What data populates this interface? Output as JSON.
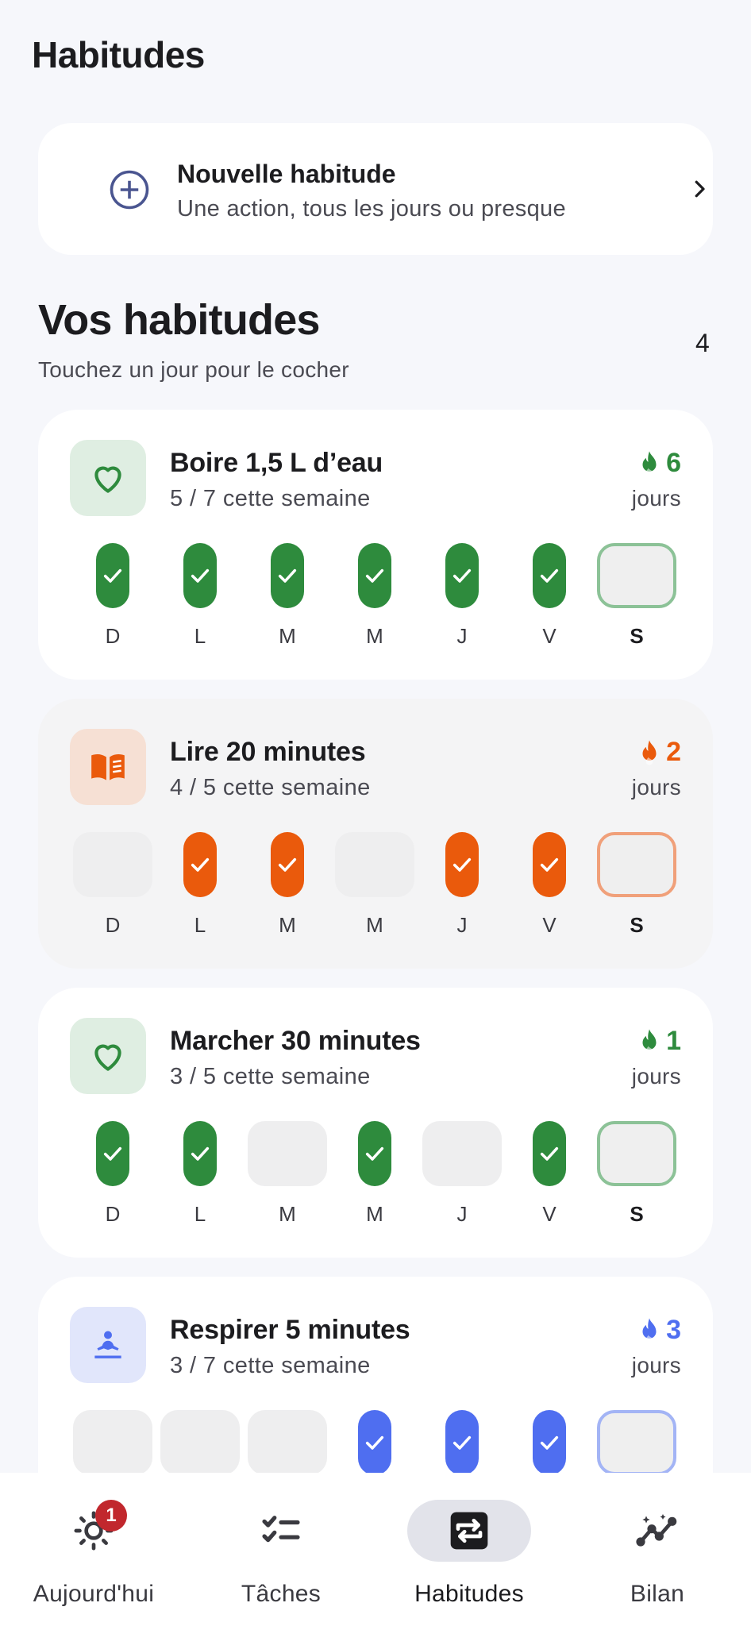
{
  "page": {
    "title": "Habitudes"
  },
  "new_habit": {
    "title": "Nouvelle habitude",
    "subtitle": "Une action, tous les jours ou presque",
    "icon": "plus-circle-icon"
  },
  "section": {
    "title": "Vos habitudes",
    "subtitle": "Touchez un jour pour le cocher",
    "count": "4"
  },
  "day_labels": [
    "D",
    "L",
    "M",
    "M",
    "J",
    "V",
    "S"
  ],
  "habits": [
    {
      "name": "Boire 1,5 L d’eau",
      "progress": "5 / 7 cette semaine",
      "streak": "6",
      "streak_unit": "jours",
      "icon": "heart-icon",
      "accent": "#2e8b3d",
      "icon_bg": "#dfeee2",
      "today_border": "#8cc297",
      "card_bg": "#ffffff",
      "days": [
        true,
        true,
        true,
        true,
        true,
        true,
        null
      ]
    },
    {
      "name": "Lire 20 minutes",
      "progress": "4 / 5 cette semaine",
      "streak": "2",
      "streak_unit": "jours",
      "icon": "book-icon",
      "accent": "#ea5a0c",
      "icon_bg": "#f6e0d4",
      "today_border": "#f0a07a",
      "card_bg": "#f4f4f5",
      "days": [
        false,
        true,
        true,
        false,
        true,
        true,
        null
      ]
    },
    {
      "name": "Marcher 30 minutes",
      "progress": "3 / 5 cette semaine",
      "streak": "1",
      "streak_unit": "jours",
      "icon": "heart-icon",
      "accent": "#2e8b3d",
      "icon_bg": "#dfeee2",
      "today_border": "#8cc297",
      "card_bg": "#ffffff",
      "days": [
        true,
        true,
        false,
        true,
        false,
        true,
        null
      ]
    },
    {
      "name": "Respirer 5 minutes",
      "progress": "3 / 7 cette semaine",
      "streak": "3",
      "streak_unit": "jours",
      "icon": "meditation-icon",
      "accent": "#4f6ef0",
      "icon_bg": "#e1e6fb",
      "today_border": "#a3b4f5",
      "card_bg": "#ffffff",
      "days": [
        false,
        false,
        false,
        true,
        true,
        true,
        null
      ]
    }
  ],
  "nav": {
    "items": [
      {
        "label": "Aujourd'hui",
        "icon": "sun-icon",
        "badge": "1",
        "active": false
      },
      {
        "label": "Tâches",
        "icon": "checklist-icon",
        "active": false
      },
      {
        "label": "Habitudes",
        "icon": "repeat-icon",
        "active": true
      },
      {
        "label": "Bilan",
        "icon": "insights-icon",
        "active": false
      }
    ]
  }
}
